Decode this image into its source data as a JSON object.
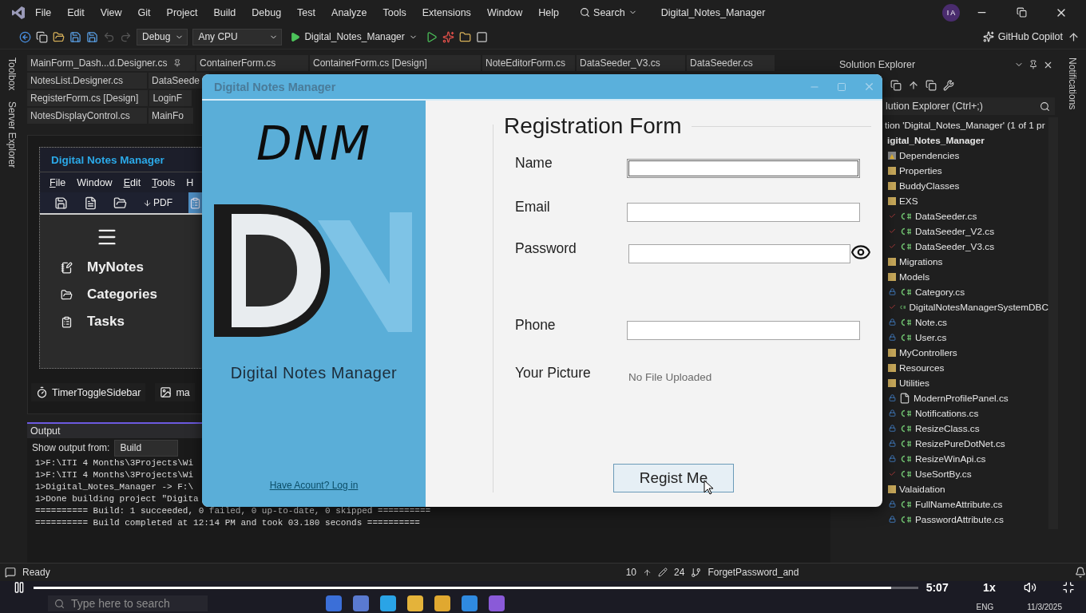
{
  "menu": [
    "File",
    "Edit",
    "View",
    "Git",
    "Project",
    "Build",
    "Debug",
    "Test",
    "Analyze",
    "Tools",
    "Extensions",
    "Window",
    "Help"
  ],
  "search": {
    "label": "Search"
  },
  "solution_title": "Digital_Notes_Manager",
  "account": {
    "initials": "I A"
  },
  "toolbar": {
    "configuration": "Debug",
    "platform": "Any CPU",
    "startup": "Digital_Notes_Manager",
    "copilot": "GitHub Copilot"
  },
  "side_tabs_left": [
    "Toolbox",
    "Server Explorer"
  ],
  "side_tabs_right": [
    "Notifications"
  ],
  "editor_tabs": [
    [
      {
        "label": "MainForm_Dash...d.Designer.cs",
        "pinned": true
      },
      {
        "label": "ContainerForm.cs",
        "pinned": false
      },
      {
        "label": "ContainerForm.cs [Design]",
        "pinned": false
      },
      {
        "label": "NoteEditorForm.cs",
        "pinned": false
      },
      {
        "label": "DataSeeder_V3.cs",
        "pinned": false
      },
      {
        "label": "DataSeeder.cs",
        "pinned": false
      }
    ],
    [
      {
        "label": "NotesList.Designer.cs",
        "pinned": false
      },
      {
        "label": "DataSeede",
        "pinned": false
      }
    ],
    [
      {
        "label": "RegisterForm.cs [Design]",
        "pinned": false
      },
      {
        "label": "LoginF",
        "pinned": false
      }
    ],
    [
      {
        "label": "NotesDisplayControl.cs",
        "pinned": false
      },
      {
        "label": "MainFo",
        "pinned": false
      }
    ]
  ],
  "designer": {
    "title": "Digital Notes Manager",
    "menu": [
      {
        "label": "File",
        "mnemonic": true
      },
      {
        "label": "Window",
        "mnemonic": false
      },
      {
        "label": "Edit",
        "mnemonic": true
      },
      {
        "label": "Tools",
        "mnemonic": true
      },
      {
        "label": "H",
        "mnemonic": false
      }
    ],
    "toolbar_label": "PDF",
    "nav": [
      {
        "label": "MyNotes",
        "kind": "notes"
      },
      {
        "label": "Categories",
        "kind": "folder"
      },
      {
        "label": "Tasks",
        "kind": "list"
      }
    ],
    "components": [
      {
        "label": "TimerToggleSidebar",
        "kind": "timer"
      },
      {
        "label": "ma",
        "kind": "image"
      }
    ]
  },
  "output": {
    "title": "Output",
    "source_label": "Show output from:",
    "source": "Build",
    "lines": [
      "1>F:\\ITI 4 Months\\3Projects\\Wi",
      "1>F:\\ITI 4 Months\\3Projects\\Wi",
      "1>Digital_Notes_Manager -> F:\\",
      "1>Done building project \"Digita",
      "========== Build: 1 succeeded, 0 failed, 0 up-to-date, 0 skipped ==========",
      "========== Build completed at 12:14 PM and took 03.180 seconds =========="
    ]
  },
  "dialog": {
    "title": "Digital Notes Manager",
    "logo_text": "DNM",
    "app_name": "Digital Notes Manager",
    "login_link": "Have Acount? Log in",
    "heading": "Registration Form",
    "fields": [
      {
        "label": "Name",
        "kind": "text",
        "focused": true
      },
      {
        "label": "Email",
        "kind": "text",
        "focused": false
      },
      {
        "label": "Password",
        "kind": "password",
        "focused": false
      },
      {
        "label": "Phone",
        "kind": "text",
        "focused": false
      },
      {
        "label": "Your Picture",
        "kind": "file",
        "value": "No File Uploaded"
      }
    ],
    "submit": "Regist Me"
  },
  "solution_explorer": {
    "title": "Solution Explorer",
    "search": "lution Explorer (Ctrl+;)",
    "tree": [
      {
        "label": "tion 'Digital_Notes_Manager' (1 of 1 pr",
        "kind": "solution",
        "children": [
          {
            "label": "igital_Notes_Manager",
            "kind": "project",
            "children": [
              {
                "label": "Dependencies",
                "kind": "dependencies"
              },
              {
                "label": "Properties",
                "kind": "folder"
              },
              {
                "label": "BuddyClasses",
                "kind": "folder"
              },
              {
                "label": "EXS",
                "kind": "folder",
                "children": [
                  {
                    "label": "DataSeeder.cs",
                    "kind": "csharp",
                    "locked": false
                  },
                  {
                    "label": "DataSeeder_V2.cs",
                    "kind": "csharp",
                    "locked": false
                  },
                  {
                    "label": "DataSeeder_V3.cs",
                    "kind": "csharp",
                    "locked": false
                  }
                ]
              },
              {
                "label": "Migrations",
                "kind": "folder"
              },
              {
                "label": "Models",
                "kind": "folder",
                "children": [
                  {
                    "label": "Category.cs",
                    "kind": "csharp",
                    "locked": true
                  },
                  {
                    "label": "DigitalNotesManagerSystemDBC",
                    "kind": "csharp",
                    "locked": false
                  },
                  {
                    "label": "Note.cs",
                    "kind": "csharp",
                    "locked": true
                  },
                  {
                    "label": "User.cs",
                    "kind": "csharp",
                    "locked": true
                  }
                ]
              },
              {
                "label": "MyControllers",
                "kind": "folder"
              },
              {
                "label": "Resources",
                "kind": "folder"
              },
              {
                "label": "Utilities",
                "kind": "folder",
                "children": [
                  {
                    "label": "ModernProfilePanel.cs",
                    "kind": "file",
                    "locked": true
                  },
                  {
                    "label": "Notifications.cs",
                    "kind": "csharp",
                    "locked": true
                  },
                  {
                    "label": "ResizeClass.cs",
                    "kind": "csharp",
                    "locked": true
                  },
                  {
                    "label": "ResizePureDotNet.cs",
                    "kind": "csharp",
                    "locked": true
                  },
                  {
                    "label": "ResizeWinApi.cs",
                    "kind": "csharp",
                    "locked": true
                  },
                  {
                    "label": "UseSortBy.cs",
                    "kind": "csharp",
                    "locked": false
                  }
                ]
              },
              {
                "label": "Valaidation",
                "kind": "folder",
                "children": [
                  {
                    "label": "FullNameAttribute.cs",
                    "kind": "csharp",
                    "locked": true
                  },
                  {
                    "label": "PasswordAttribute.cs",
                    "kind": "csharp",
                    "locked": true
                  }
                ]
              }
            ]
          }
        ]
      }
    ]
  },
  "status_bar": {
    "text": "Ready",
    "errors": "10",
    "edits": "24",
    "branch": "ForgetPassword_and"
  },
  "taskbar": {
    "search_placeholder": "Type here to search",
    "language": "ENG",
    "date": "11/3/2025"
  },
  "player": {
    "playing": true,
    "level": 0.97,
    "time": "5:07",
    "speed": "1x"
  }
}
